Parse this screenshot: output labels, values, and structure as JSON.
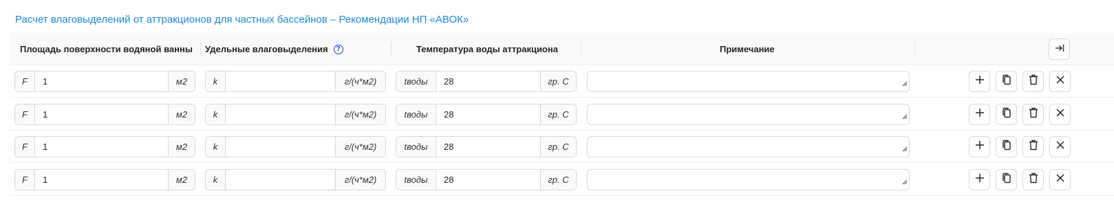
{
  "title": "Расчет влаговыделений от аттракционов для частных бассейнов – Рекомендации НП «АВОК»",
  "columns": {
    "area": "Площадь поверхности водяной ванны",
    "specific": "Удельные влаговыделения",
    "temp": "Температура воды аттракциона",
    "note": "Примечание"
  },
  "help_glyph": "?",
  "icons": {
    "collapse": "collapse-right-icon",
    "add": "plus-icon",
    "copy": "copy-icon",
    "delete": "trash-icon",
    "close": "close-icon"
  },
  "colors": {
    "accent": "#1e88e5",
    "help": "#2b3bd6"
  },
  "rows": [
    {
      "area": {
        "prefix": "F",
        "value": "1",
        "unit": "м2"
      },
      "specific": {
        "prefix": "k",
        "value": "",
        "unit": "г/(ч*м2)"
      },
      "temp": {
        "prefix": "tводы",
        "value": "28",
        "unit": "гр. С"
      },
      "note": ""
    },
    {
      "area": {
        "prefix": "F",
        "value": "1",
        "unit": "м2"
      },
      "specific": {
        "prefix": "k",
        "value": "",
        "unit": "г/(ч*м2)"
      },
      "temp": {
        "prefix": "tводы",
        "value": "28",
        "unit": "гр. С"
      },
      "note": ""
    },
    {
      "area": {
        "prefix": "F",
        "value": "1",
        "unit": "м2"
      },
      "specific": {
        "prefix": "k",
        "value": "",
        "unit": "г/(ч*м2)"
      },
      "temp": {
        "prefix": "tводы",
        "value": "28",
        "unit": "гр. С"
      },
      "note": ""
    },
    {
      "area": {
        "prefix": "F",
        "value": "1",
        "unit": "м2"
      },
      "specific": {
        "prefix": "k",
        "value": "",
        "unit": "г/(ч*м2)"
      },
      "temp": {
        "prefix": "tводы",
        "value": "28",
        "unit": "гр. С"
      },
      "note": ""
    }
  ]
}
